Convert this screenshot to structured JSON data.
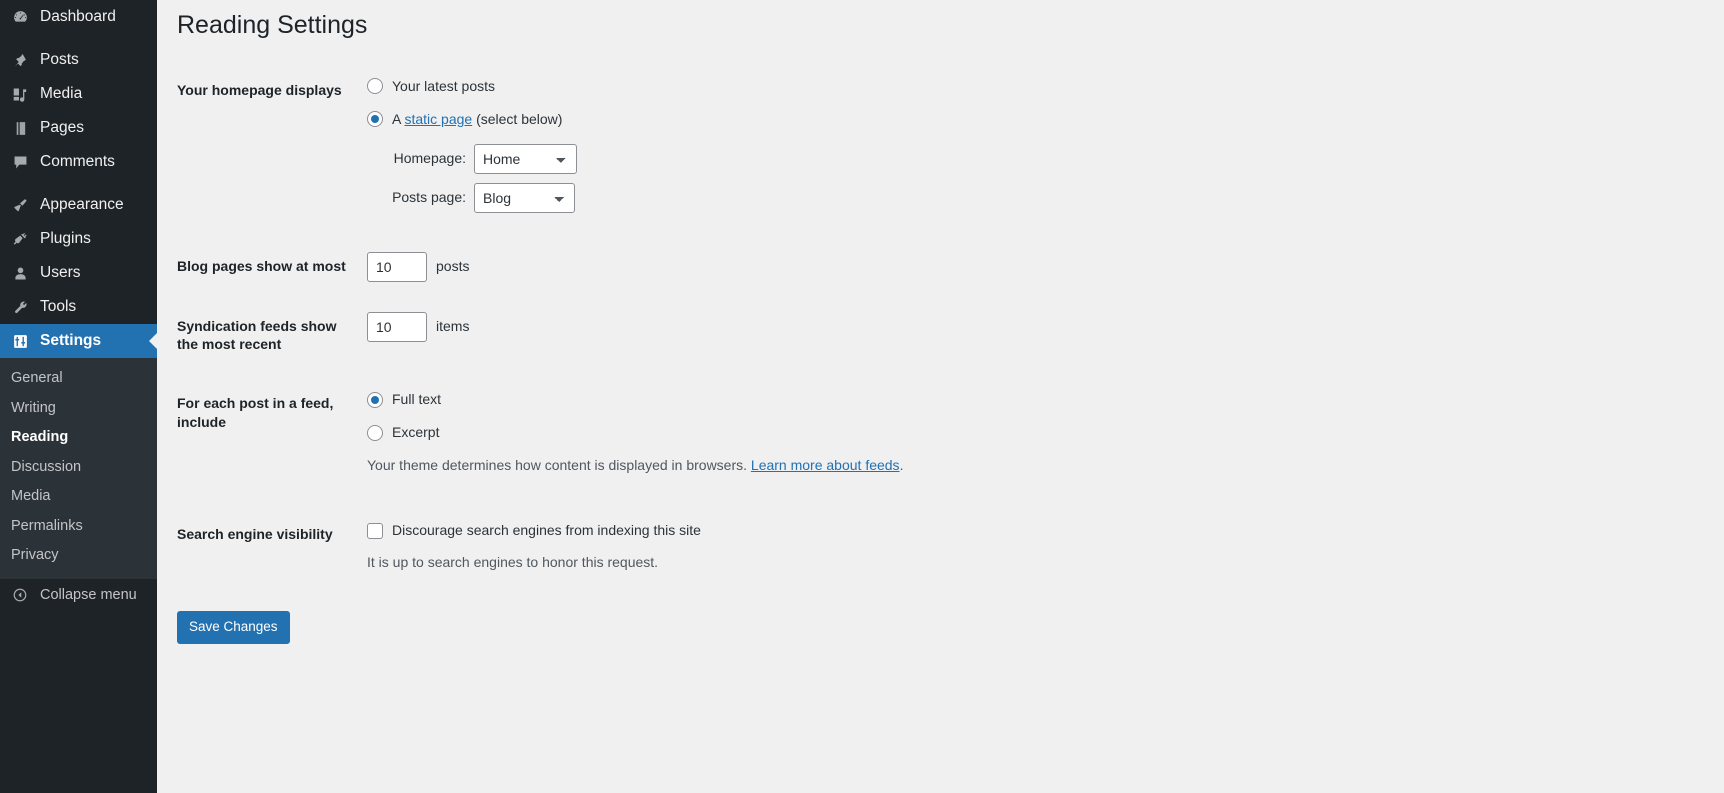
{
  "sidebar": {
    "items": [
      {
        "label": "Dashboard",
        "icon": "dashboard-icon",
        "current": false
      },
      {
        "label": "Posts",
        "icon": "pin-icon",
        "current": false
      },
      {
        "label": "Media",
        "icon": "media-icon",
        "current": false
      },
      {
        "label": "Pages",
        "icon": "pages-icon",
        "current": false
      },
      {
        "label": "Comments",
        "icon": "comments-icon",
        "current": false
      },
      {
        "label": "Appearance",
        "icon": "paintbrush-icon",
        "current": false
      },
      {
        "label": "Plugins",
        "icon": "plug-icon",
        "current": false
      },
      {
        "label": "Users",
        "icon": "user-icon",
        "current": false
      },
      {
        "label": "Tools",
        "icon": "wrench-icon",
        "current": false
      },
      {
        "label": "Settings",
        "icon": "sliders-icon",
        "current": true
      }
    ],
    "submenu": [
      {
        "label": "General",
        "current": false
      },
      {
        "label": "Writing",
        "current": false
      },
      {
        "label": "Reading",
        "current": true
      },
      {
        "label": "Discussion",
        "current": false
      },
      {
        "label": "Media",
        "current": false
      },
      {
        "label": "Permalinks",
        "current": false
      },
      {
        "label": "Privacy",
        "current": false
      }
    ],
    "collapse_label": "Collapse menu",
    "collapse_icon": "chevron-left-circle-icon",
    "bg_color": "#1d2327",
    "submenu_bg_color": "#2c3338",
    "current_color": "#2271b1"
  },
  "page": {
    "title": "Reading Settings"
  },
  "homepage_displays": {
    "label": "Your homepage displays",
    "option_latest": "Your latest posts",
    "option_static_prefix": "A ",
    "option_static_link": "static page",
    "option_static_suffix": " (select below)",
    "selected": "static",
    "homepage_label": "Homepage:",
    "homepage_value": "Home",
    "homepage_options": [
      "Home",
      "Blog"
    ],
    "posts_page_label": "Posts page:",
    "posts_page_value": "Blog",
    "posts_page_options": [
      "Home",
      "Blog"
    ]
  },
  "blog_pages": {
    "label": "Blog pages show at most",
    "value": "10",
    "suffix": "posts"
  },
  "syndication": {
    "label": "Syndication feeds show the most recent",
    "value": "10",
    "suffix": "items"
  },
  "feed_content": {
    "label": "For each post in a feed, include",
    "option_full": "Full text",
    "option_excerpt": "Excerpt",
    "selected": "full",
    "description_prefix": "Your theme determines how content is displayed in browsers. ",
    "description_link": "Learn more about feeds",
    "description_suffix": "."
  },
  "search_visibility": {
    "label": "Search engine visibility",
    "checkbox_label": "Discourage search engines from indexing this site",
    "checked": false,
    "description": "It is up to search engines to honor this request."
  },
  "actions": {
    "save_label": "Save Changes",
    "primary_color": "#2271b1"
  }
}
